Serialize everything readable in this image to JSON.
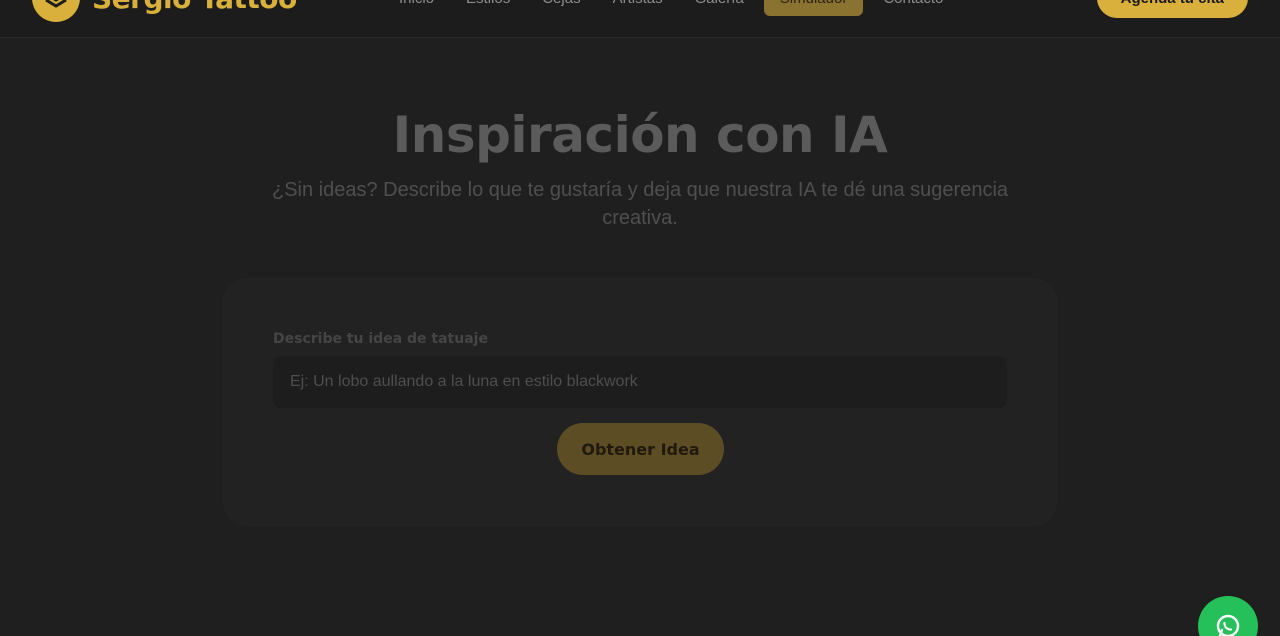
{
  "brand": {
    "name": "Sergio Tattoo",
    "accent": "#d9b03b"
  },
  "nav": {
    "items": [
      {
        "label": "Inicio",
        "active": false
      },
      {
        "label": "Estilos",
        "active": false
      },
      {
        "label": "Cejas",
        "active": false
      },
      {
        "label": "Artistas",
        "active": false
      },
      {
        "label": "Galería",
        "active": false
      },
      {
        "label": "Simulador",
        "active": true
      },
      {
        "label": "Contacto",
        "active": false
      }
    ],
    "cta_label": "Agenda tu cita"
  },
  "hero": {
    "title": "Inspiración con IA",
    "subtitle": "¿Sin ideas? Describe lo que te gustaría y deja que nuestra IA te dé una sugerencia creativa."
  },
  "form": {
    "label": "Describe tu idea de tatuaje",
    "placeholder": "Ej: Un lobo aullando a la luna en estilo blackwork",
    "value": "",
    "submit_label": "Obtener Idea"
  },
  "floating": {
    "icon": "whatsapp-icon",
    "color": "#25c05a"
  }
}
